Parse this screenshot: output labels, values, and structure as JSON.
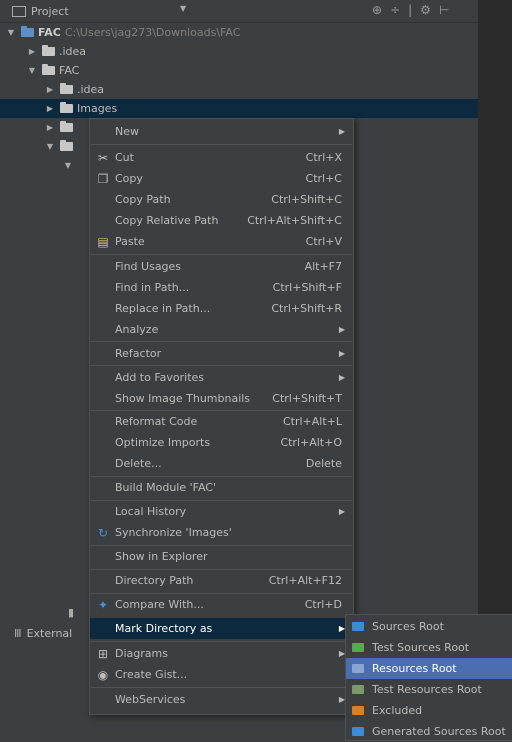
{
  "panel": {
    "title": "Project"
  },
  "tree": [
    {
      "text": "FAC",
      "path": "C:\\Users\\jag273\\Downloads\\FAC"
    },
    {
      "text": ".idea"
    },
    {
      "text": "FAC"
    },
    {
      "text": ".idea"
    },
    {
      "text": "Images"
    }
  ],
  "bottom_tree": {
    "external": "External"
  },
  "menu": {
    "new": "New",
    "cut": "Cut",
    "cut_sc": "Ctrl+X",
    "copy": "Copy",
    "copy_sc": "Ctrl+C",
    "copy_path": "Copy Path",
    "copy_path_sc": "Ctrl+Shift+C",
    "copy_rel": "Copy Relative Path",
    "copy_rel_sc": "Ctrl+Alt+Shift+C",
    "paste": "Paste",
    "paste_sc": "Ctrl+V",
    "find_usages": "Find Usages",
    "find_usages_sc": "Alt+F7",
    "find_path": "Find in Path...",
    "find_path_sc": "Ctrl+Shift+F",
    "replace_path": "Replace in Path...",
    "replace_path_sc": "Ctrl+Shift+R",
    "analyze": "Analyze",
    "refactor": "Refactor",
    "favorites": "Add to Favorites",
    "thumbs": "Show Image Thumbnails",
    "thumbs_sc": "Ctrl+Shift+T",
    "reformat": "Reformat Code",
    "reformat_sc": "Ctrl+Alt+L",
    "optimize": "Optimize Imports",
    "optimize_sc": "Ctrl+Alt+O",
    "delete": "Delete...",
    "delete_sc": "Delete",
    "build": "Build Module 'FAC'",
    "history": "Local History",
    "sync": "Synchronize 'Images'",
    "explorer": "Show in Explorer",
    "dirpath": "Directory Path",
    "dirpath_sc": "Ctrl+Alt+F12",
    "compare": "Compare With...",
    "compare_sc": "Ctrl+D",
    "mark": "Mark Directory as",
    "diagrams": "Diagrams",
    "gist": "Create Gist...",
    "webservices": "WebServices"
  },
  "submenu": [
    {
      "label": "Sources Root",
      "color": "#3c8bd6"
    },
    {
      "label": "Test Sources Root",
      "color": "#4caf50"
    },
    {
      "label": "Resources Root",
      "color": "#6a8fc0"
    },
    {
      "label": "Test Resources Root",
      "color": "#7a9a6a"
    },
    {
      "label": "Excluded",
      "color": "#d2822e"
    },
    {
      "label": "Generated Sources Root",
      "color": "#3c8bd6"
    }
  ]
}
